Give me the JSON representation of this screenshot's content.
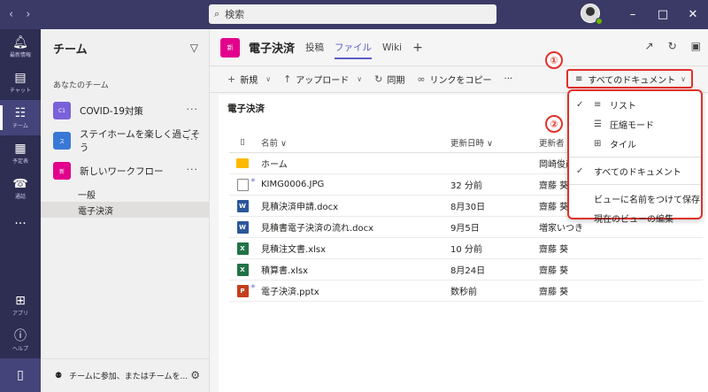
{
  "search": {
    "label": "検索"
  },
  "rail": {
    "items": [
      {
        "label": "最新情報",
        "icon": "bell-icon"
      },
      {
        "label": "チャット",
        "icon": "chat-icon"
      },
      {
        "label": "チーム",
        "icon": "teams-icon"
      },
      {
        "label": "予定表",
        "icon": "calendar-icon"
      },
      {
        "label": "通話",
        "icon": "phone-icon"
      }
    ],
    "apps_label": "アプリ",
    "help_label": "ヘルプ"
  },
  "teams_panel": {
    "title": "チーム",
    "section_label": "あなたのチーム",
    "teams": [
      {
        "name": "COVID-19対策",
        "initials": "C1",
        "color": "#7b61d9"
      },
      {
        "name": "ステイホームを楽しく過ごそう",
        "initials": "ス",
        "color": "#3a78d6"
      },
      {
        "name": "新しいワークフロー",
        "initials": "新",
        "color": "#e3008c"
      }
    ],
    "channels": [
      "一般",
      "電子決済"
    ],
    "footer_label": "チームに参加、またはチームを..."
  },
  "channel_header": {
    "avatar": "新",
    "title": "電子決済",
    "tabs": [
      "投稿",
      "ファイル",
      "Wiki"
    ]
  },
  "toolbar": {
    "new": "新規",
    "upload": "アップロード",
    "sync": "同期",
    "copy_link": "リンクをコピー",
    "more": "···",
    "view_selector": "すべてのドキュメント"
  },
  "content": {
    "breadcrumb": "電子決済",
    "columns": {
      "name": "名前",
      "modified": "更新日時",
      "modified_by": "更新者"
    },
    "files": [
      {
        "name": "ホーム",
        "modified": "",
        "by": "岡崎俊彦",
        "type": "folder"
      },
      {
        "name": "KIMG0006.JPG",
        "modified": "32 分前",
        "by": "齋藤 葵",
        "type": "img"
      },
      {
        "name": "見積決済申請.docx",
        "modified": "8月30日",
        "by": "齋藤 葵",
        "type": "word"
      },
      {
        "name": "見積書電子決済の流れ.docx",
        "modified": "9月5日",
        "by": "増家いつき",
        "type": "word"
      },
      {
        "name": "見積注文書.xlsx",
        "modified": "10 分前",
        "by": "齋藤 葵",
        "type": "excel"
      },
      {
        "name": "積算書.xlsx",
        "modified": "8月24日",
        "by": "齋藤 葵",
        "type": "excel"
      },
      {
        "name": "電子決済.pptx",
        "modified": "数秒前",
        "by": "齋藤 葵",
        "type": "ppt"
      }
    ]
  },
  "dropdown": {
    "items": [
      "リスト",
      "圧縮モード",
      "タイル"
    ],
    "all_docs": "すべてのドキュメント",
    "save_view": "ビューに名前をつけて保存",
    "edit_view": "現在のビューの編集"
  },
  "callouts": [
    "①",
    "②"
  ]
}
